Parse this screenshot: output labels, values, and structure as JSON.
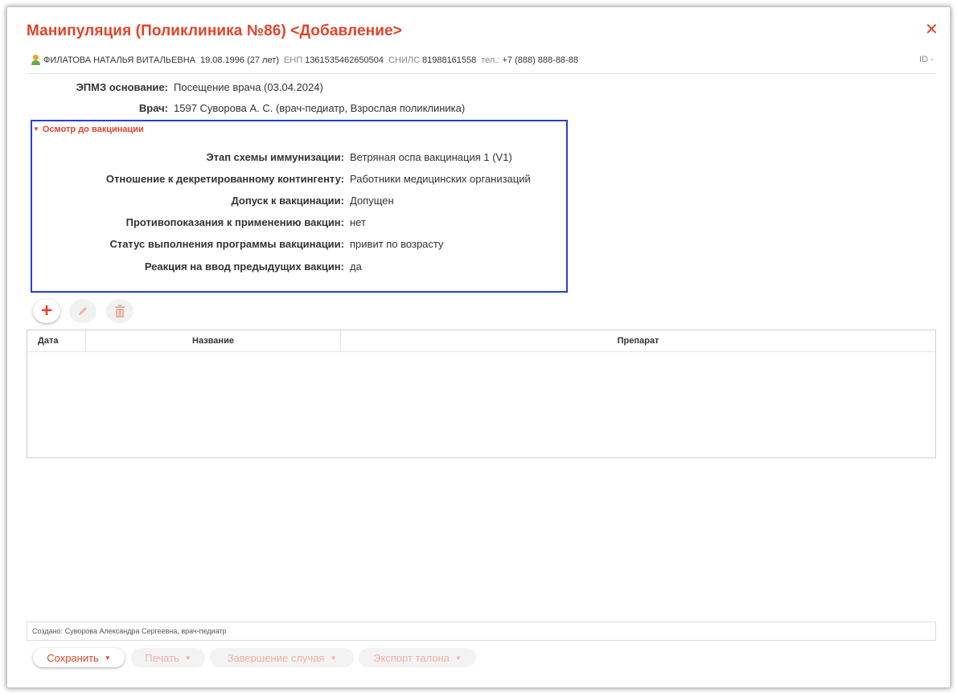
{
  "window": {
    "title": "Манипуляция (Поликлиника №86) <Добавление>",
    "close_icon": "close-icon"
  },
  "patient": {
    "name": "ФИЛАТОВА НАТАЛЬЯ ВИТАЛЬЕВНА",
    "dob": "19.08.1996 (27 лет)",
    "enp_label": "ЕНП",
    "enp": "1361535462650504",
    "snils_label": "СНИЛС",
    "snils": "81988161558",
    "phone_label": "тел.:",
    "phone": "+7 (888) 888-88-88",
    "id": "ID -"
  },
  "basis": {
    "label": "ЭПМЗ основание:",
    "value": "Посещение врача (03.04.2024)"
  },
  "doctor": {
    "label": "Врач:",
    "value": "1597 Суворова А. С.  (врач-педиатр, Взрослая поликлиника)"
  },
  "exam": {
    "title": "Осмотр до вакцинации",
    "fields": [
      {
        "label": "Этап схемы иммунизации:",
        "value": "Ветряная оспа вакцинация 1 (V1)"
      },
      {
        "label": "Отношение к декретированному контингенту:",
        "value": "Работники медицинских организаций"
      },
      {
        "label": "Допуск к вакцинации:",
        "value": "Допущен"
      },
      {
        "label": "Противопоказания к применению вакцин:",
        "value": "нет"
      },
      {
        "label": "Статус выполнения программы вакцинации:",
        "value": "привит по возрасту"
      },
      {
        "label": "Реакция на ввод предыдущих вакцин:",
        "value": "да"
      }
    ]
  },
  "toolbar": {
    "add_icon": "plus-icon",
    "edit_icon": "pencil-icon",
    "delete_icon": "trash-icon"
  },
  "table": {
    "columns": [
      "Дата",
      "Название",
      "Препарат"
    ],
    "rows": []
  },
  "footer": {
    "created": "Создано: Суворова Александра Сергеевна, врач-педиатр",
    "save_label": "Сохранить",
    "print_label": "Печать",
    "finish_label": "Завершение случая",
    "export_label": "Экспорт талона"
  },
  "colors": {
    "accent": "#e0442b",
    "section_border": "#2a3fd6"
  }
}
